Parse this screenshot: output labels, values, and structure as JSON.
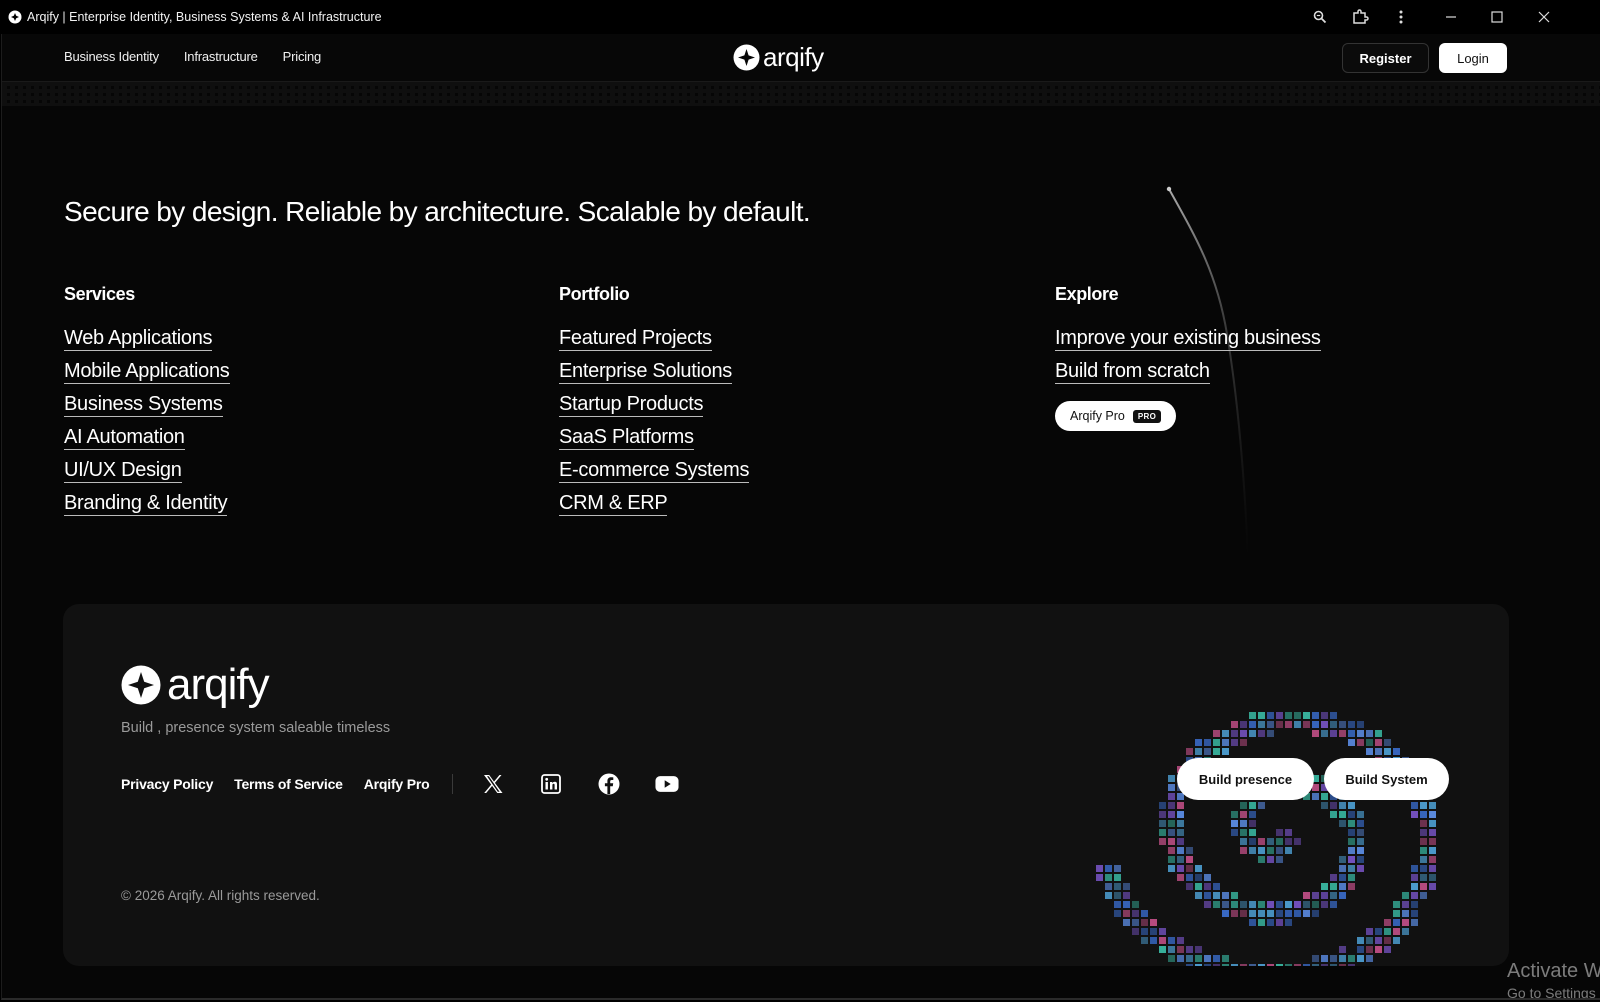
{
  "browser": {
    "title": "Arqify | Enterprise Identity, Business Systems & AI Infrastructure"
  },
  "nav": {
    "links": [
      "Business Identity",
      "Infrastructure",
      "Pricing"
    ],
    "brand": "arqify",
    "register": "Register",
    "login": "Login"
  },
  "hero": {
    "tagline": "Secure by design. Reliable by architecture. Scalable by default."
  },
  "columns": {
    "services": {
      "heading": "Services",
      "items": [
        "Web Applications",
        "Mobile Applications",
        "Business Systems",
        "AI Automation",
        "UI/UX Design",
        "Branding & Identity"
      ]
    },
    "portfolio": {
      "heading": "Portfolio",
      "items": [
        "Featured Projects",
        "Enterprise Solutions",
        "Startup Products",
        "SaaS Platforms",
        "E-commerce Systems",
        "CRM & ERP"
      ]
    },
    "explore": {
      "heading": "Explore",
      "items": [
        "Improve your existing business",
        "Build from scratch"
      ],
      "pro_label": "Arqify Pro",
      "pro_badge": "PRO"
    }
  },
  "footer": {
    "brand": "arqify",
    "tagline": "Build , presence system saleable timeless",
    "links": [
      "Privacy Policy",
      "Terms of Service",
      "Arqify Pro"
    ],
    "social_icons": [
      "x-icon",
      "linkedin-icon",
      "facebook-icon",
      "youtube-icon"
    ],
    "cta_presence": "Build presence",
    "cta_system": "Build System",
    "copyright": "© 2026 Arqify. All rights reserved."
  },
  "watermark": {
    "line1": "Activate W",
    "line2": "Go to Settings"
  },
  "colors": {
    "background": "#060606",
    "footer_card": "#111111",
    "muted_text": "#9a9a9a",
    "spiral_palette": [
      "#3b6fd1",
      "#4fa3d8",
      "#39b9a3",
      "#7a55c9",
      "#c04f86",
      "#5d8fe8"
    ]
  }
}
